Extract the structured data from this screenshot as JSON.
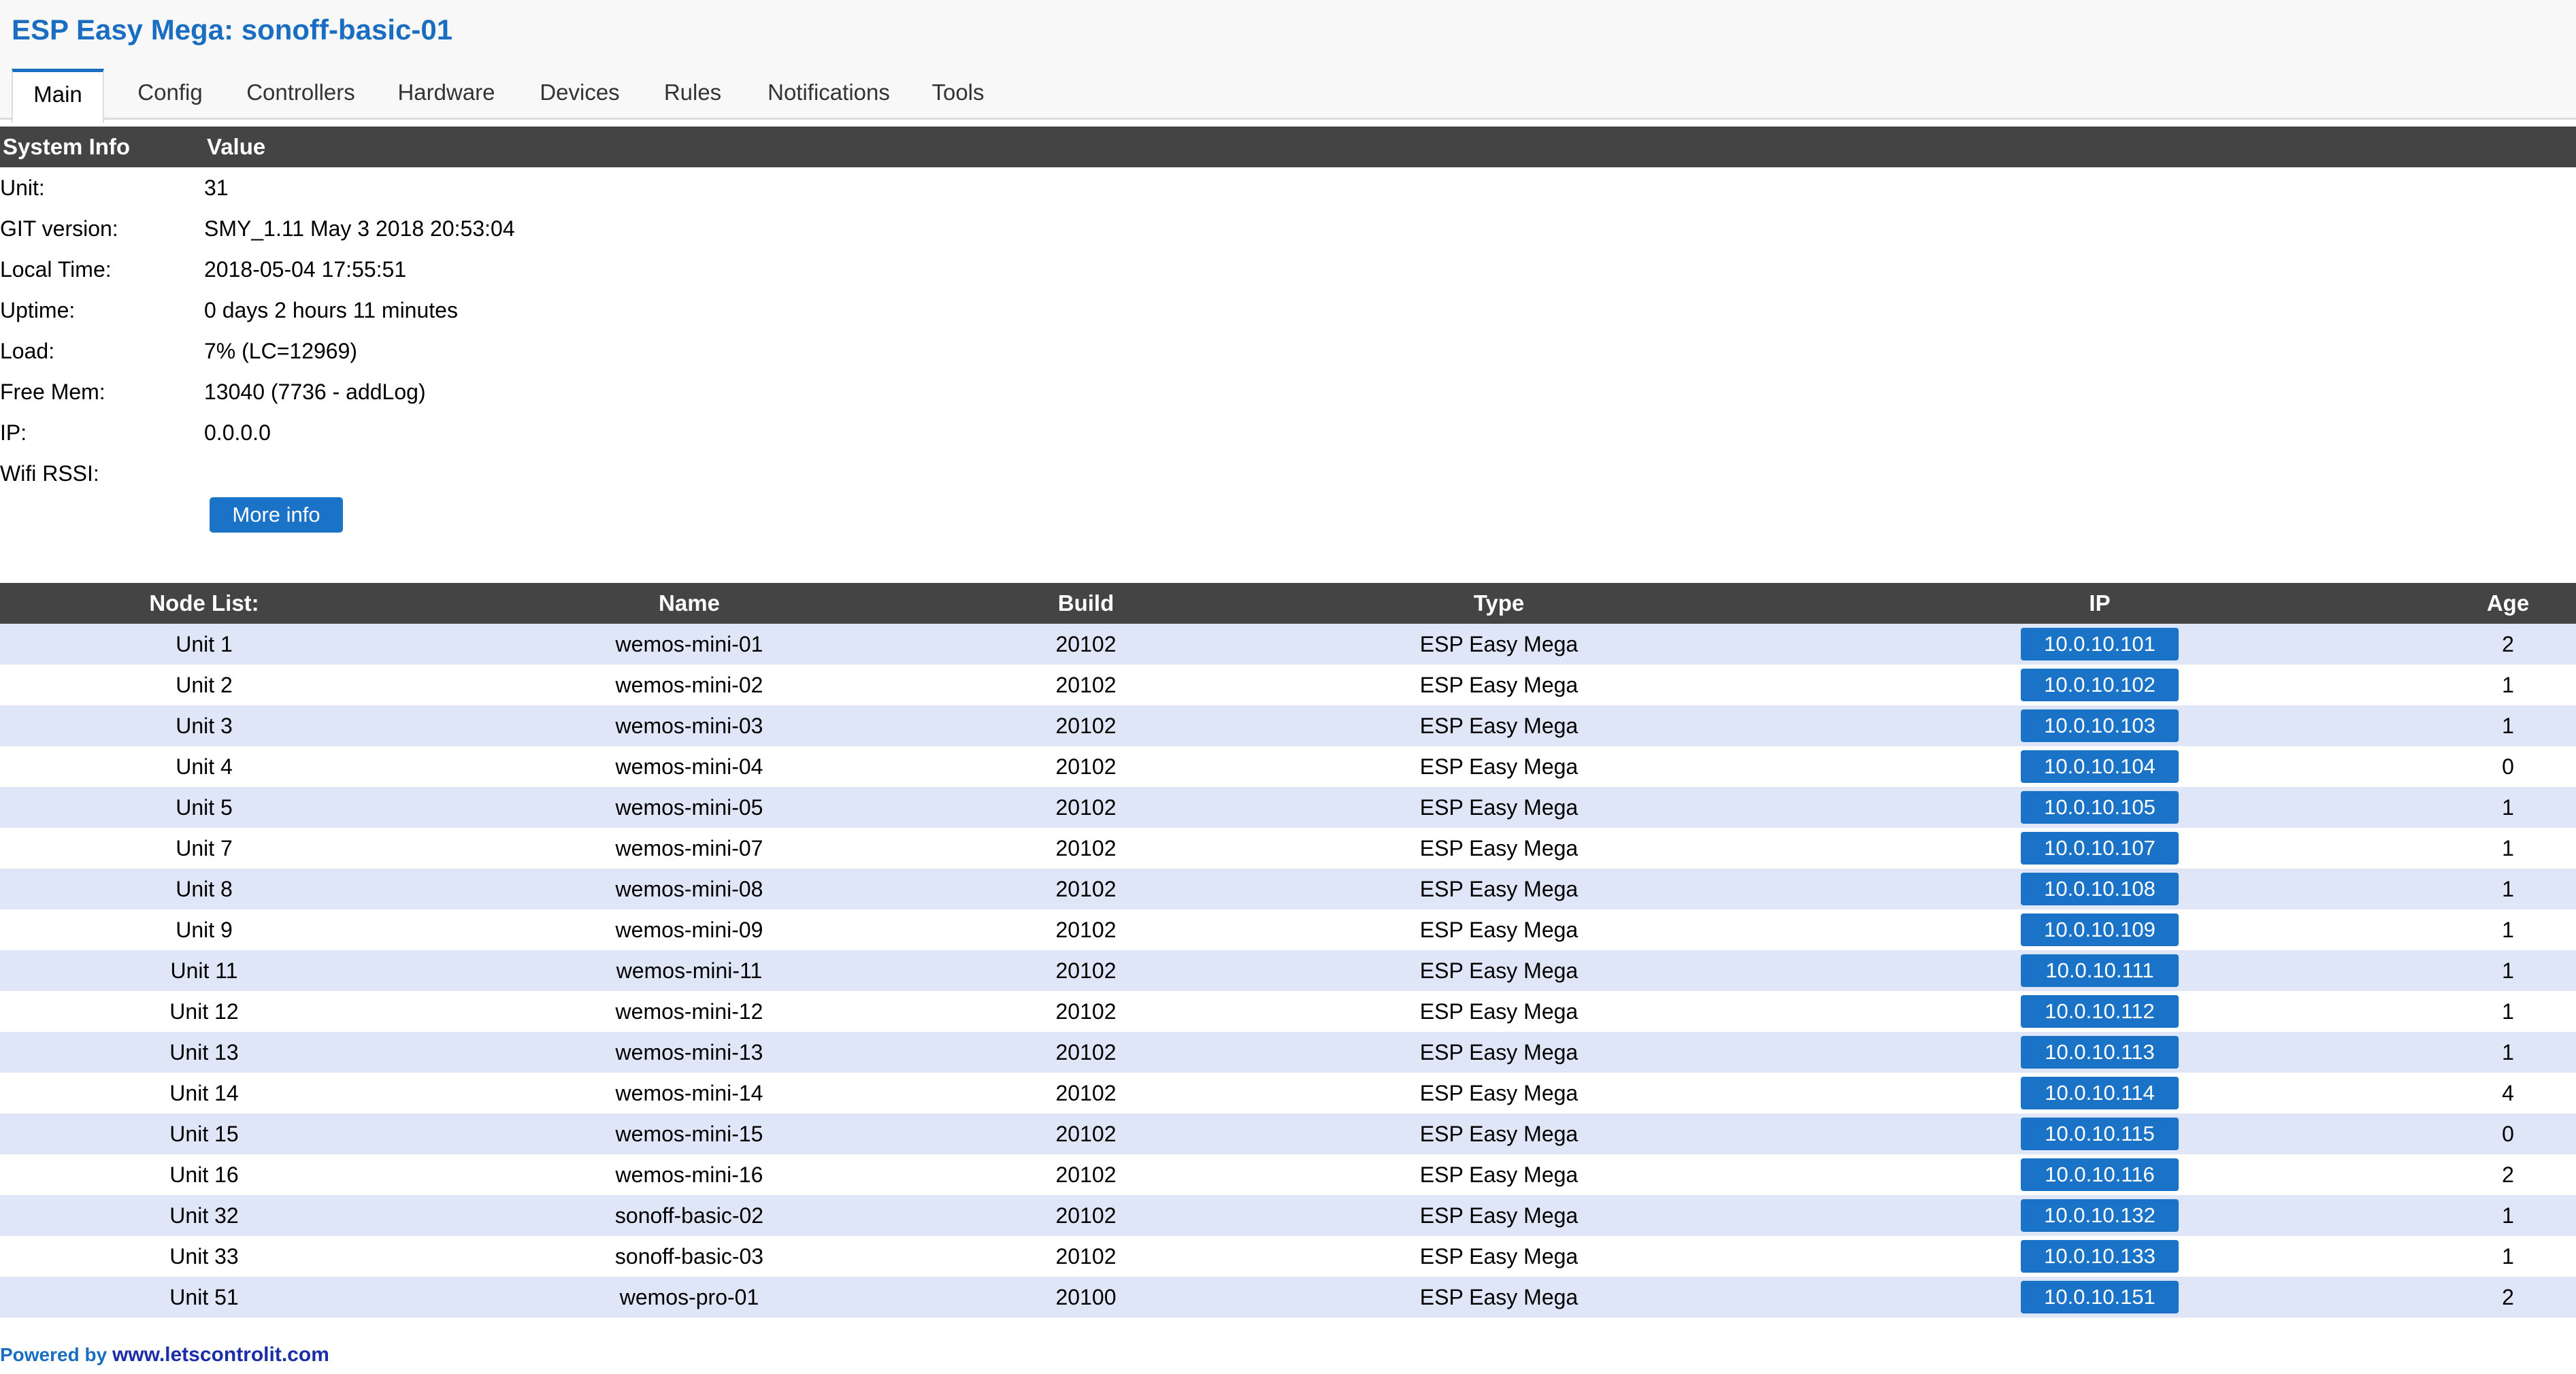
{
  "app": {
    "title": "ESP Easy Mega: sonoff-basic-01"
  },
  "tabs": [
    {
      "label": "Main",
      "active": true
    },
    {
      "label": "Config"
    },
    {
      "label": "Controllers"
    },
    {
      "label": "Hardware"
    },
    {
      "label": "Devices"
    },
    {
      "label": "Rules"
    },
    {
      "label": "Notifications"
    },
    {
      "label": "Tools"
    }
  ],
  "system_info": {
    "header": {
      "col1": "System Info",
      "col2": "Value"
    },
    "rows": [
      {
        "label": "Unit:",
        "value": "31"
      },
      {
        "label": "GIT version:",
        "value": "SMY_1.11 May 3 2018 20:53:04"
      },
      {
        "label": "Local Time:",
        "value": "2018-05-04 17:55:51"
      },
      {
        "label": "Uptime:",
        "value": "0 days 2 hours 11 minutes"
      },
      {
        "label": "Load:",
        "value": "7% (LC=12969)"
      },
      {
        "label": "Free Mem:",
        "value": "13040 (7736 - addLog)"
      },
      {
        "label": "IP:",
        "value": "0.0.0.0"
      },
      {
        "label": "Wifi RSSI:",
        "value": ""
      }
    ],
    "more_info_label": "More info"
  },
  "node_list": {
    "headers": {
      "node": "Node List:",
      "name": "Name",
      "build": "Build",
      "type": "Type",
      "ip": "IP",
      "age": "Age"
    },
    "rows": [
      {
        "unit": "Unit 1",
        "name": "wemos-mini-01",
        "build": "20102",
        "type": "ESP Easy Mega",
        "ip": "10.0.10.101",
        "age": "2"
      },
      {
        "unit": "Unit 2",
        "name": "wemos-mini-02",
        "build": "20102",
        "type": "ESP Easy Mega",
        "ip": "10.0.10.102",
        "age": "1"
      },
      {
        "unit": "Unit 3",
        "name": "wemos-mini-03",
        "build": "20102",
        "type": "ESP Easy Mega",
        "ip": "10.0.10.103",
        "age": "1"
      },
      {
        "unit": "Unit 4",
        "name": "wemos-mini-04",
        "build": "20102",
        "type": "ESP Easy Mega",
        "ip": "10.0.10.104",
        "age": "0"
      },
      {
        "unit": "Unit 5",
        "name": "wemos-mini-05",
        "build": "20102",
        "type": "ESP Easy Mega",
        "ip": "10.0.10.105",
        "age": "1"
      },
      {
        "unit": "Unit 7",
        "name": "wemos-mini-07",
        "build": "20102",
        "type": "ESP Easy Mega",
        "ip": "10.0.10.107",
        "age": "1"
      },
      {
        "unit": "Unit 8",
        "name": "wemos-mini-08",
        "build": "20102",
        "type": "ESP Easy Mega",
        "ip": "10.0.10.108",
        "age": "1"
      },
      {
        "unit": "Unit 9",
        "name": "wemos-mini-09",
        "build": "20102",
        "type": "ESP Easy Mega",
        "ip": "10.0.10.109",
        "age": "1"
      },
      {
        "unit": "Unit 11",
        "name": "wemos-mini-11",
        "build": "20102",
        "type": "ESP Easy Mega",
        "ip": "10.0.10.111",
        "age": "1"
      },
      {
        "unit": "Unit 12",
        "name": "wemos-mini-12",
        "build": "20102",
        "type": "ESP Easy Mega",
        "ip": "10.0.10.112",
        "age": "1"
      },
      {
        "unit": "Unit 13",
        "name": "wemos-mini-13",
        "build": "20102",
        "type": "ESP Easy Mega",
        "ip": "10.0.10.113",
        "age": "1"
      },
      {
        "unit": "Unit 14",
        "name": "wemos-mini-14",
        "build": "20102",
        "type": "ESP Easy Mega",
        "ip": "10.0.10.114",
        "age": "4"
      },
      {
        "unit": "Unit 15",
        "name": "wemos-mini-15",
        "build": "20102",
        "type": "ESP Easy Mega",
        "ip": "10.0.10.115",
        "age": "0"
      },
      {
        "unit": "Unit 16",
        "name": "wemos-mini-16",
        "build": "20102",
        "type": "ESP Easy Mega",
        "ip": "10.0.10.116",
        "age": "2"
      },
      {
        "unit": "Unit 32",
        "name": "sonoff-basic-02",
        "build": "20102",
        "type": "ESP Easy Mega",
        "ip": "10.0.10.132",
        "age": "1"
      },
      {
        "unit": "Unit 33",
        "name": "sonoff-basic-03",
        "build": "20102",
        "type": "ESP Easy Mega",
        "ip": "10.0.10.133",
        "age": "1"
      },
      {
        "unit": "Unit 51",
        "name": "wemos-pro-01",
        "build": "20100",
        "type": "ESP Easy Mega",
        "ip": "10.0.10.151",
        "age": "2"
      }
    ]
  },
  "footer": {
    "prefix": "Powered by ",
    "link": "www.letscontrolit.com"
  },
  "colors": {
    "accent": "#1a73c7",
    "title": "#1a6ec2",
    "header_bar": "#444444",
    "row_alt": "#dfe6f8"
  }
}
